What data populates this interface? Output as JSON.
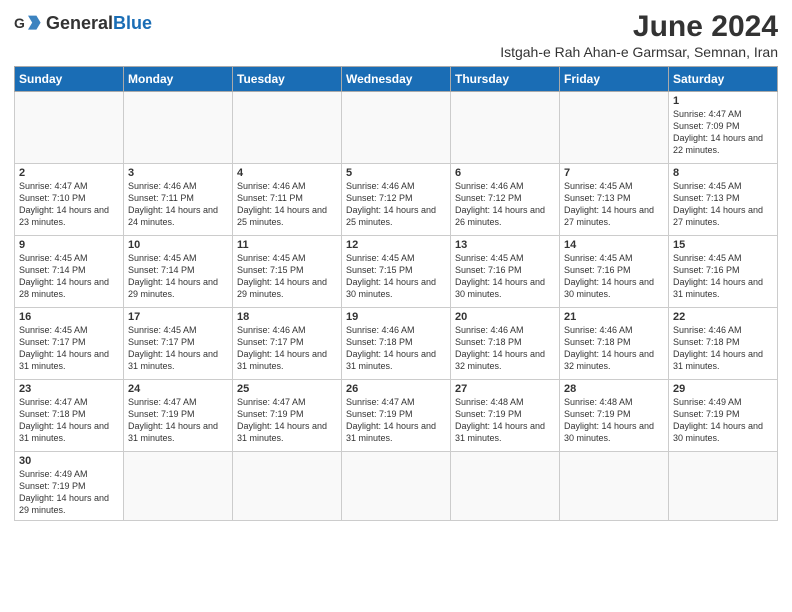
{
  "header": {
    "logo_general": "General",
    "logo_blue": "Blue",
    "month_year": "June 2024",
    "location": "Istgah-e Rah Ahan-e Garmsar, Semnan, Iran"
  },
  "weekdays": [
    "Sunday",
    "Monday",
    "Tuesday",
    "Wednesday",
    "Thursday",
    "Friday",
    "Saturday"
  ],
  "weeks": [
    [
      null,
      null,
      null,
      null,
      null,
      null,
      {
        "day": "1",
        "sunrise": "4:47 AM",
        "sunset": "7:09 PM",
        "daylight": "14 hours and 22 minutes."
      }
    ],
    [
      {
        "day": "2",
        "sunrise": "4:47 AM",
        "sunset": "7:10 PM",
        "daylight": "14 hours and 23 minutes."
      },
      {
        "day": "3",
        "sunrise": "4:46 AM",
        "sunset": "7:11 PM",
        "daylight": "14 hours and 24 minutes."
      },
      {
        "day": "4",
        "sunrise": "4:46 AM",
        "sunset": "7:11 PM",
        "daylight": "14 hours and 25 minutes."
      },
      {
        "day": "5",
        "sunrise": "4:46 AM",
        "sunset": "7:12 PM",
        "daylight": "14 hours and 25 minutes."
      },
      {
        "day": "6",
        "sunrise": "4:46 AM",
        "sunset": "7:12 PM",
        "daylight": "14 hours and 26 minutes."
      },
      {
        "day": "7",
        "sunrise": "4:45 AM",
        "sunset": "7:13 PM",
        "daylight": "14 hours and 27 minutes."
      },
      {
        "day": "8",
        "sunrise": "4:45 AM",
        "sunset": "7:13 PM",
        "daylight": "14 hours and 27 minutes."
      }
    ],
    [
      {
        "day": "9",
        "sunrise": "4:45 AM",
        "sunset": "7:14 PM",
        "daylight": "14 hours and 28 minutes."
      },
      {
        "day": "10",
        "sunrise": "4:45 AM",
        "sunset": "7:14 PM",
        "daylight": "14 hours and 29 minutes."
      },
      {
        "day": "11",
        "sunrise": "4:45 AM",
        "sunset": "7:15 PM",
        "daylight": "14 hours and 29 minutes."
      },
      {
        "day": "12",
        "sunrise": "4:45 AM",
        "sunset": "7:15 PM",
        "daylight": "14 hours and 30 minutes."
      },
      {
        "day": "13",
        "sunrise": "4:45 AM",
        "sunset": "7:16 PM",
        "daylight": "14 hours and 30 minutes."
      },
      {
        "day": "14",
        "sunrise": "4:45 AM",
        "sunset": "7:16 PM",
        "daylight": "14 hours and 30 minutes."
      },
      {
        "day": "15",
        "sunrise": "4:45 AM",
        "sunset": "7:16 PM",
        "daylight": "14 hours and 31 minutes."
      }
    ],
    [
      {
        "day": "16",
        "sunrise": "4:45 AM",
        "sunset": "7:17 PM",
        "daylight": "14 hours and 31 minutes."
      },
      {
        "day": "17",
        "sunrise": "4:45 AM",
        "sunset": "7:17 PM",
        "daylight": "14 hours and 31 minutes."
      },
      {
        "day": "18",
        "sunrise": "4:46 AM",
        "sunset": "7:17 PM",
        "daylight": "14 hours and 31 minutes."
      },
      {
        "day": "19",
        "sunrise": "4:46 AM",
        "sunset": "7:18 PM",
        "daylight": "14 hours and 31 minutes."
      },
      {
        "day": "20",
        "sunrise": "4:46 AM",
        "sunset": "7:18 PM",
        "daylight": "14 hours and 32 minutes."
      },
      {
        "day": "21",
        "sunrise": "4:46 AM",
        "sunset": "7:18 PM",
        "daylight": "14 hours and 32 minutes."
      },
      {
        "day": "22",
        "sunrise": "4:46 AM",
        "sunset": "7:18 PM",
        "daylight": "14 hours and 31 minutes."
      }
    ],
    [
      {
        "day": "23",
        "sunrise": "4:47 AM",
        "sunset": "7:18 PM",
        "daylight": "14 hours and 31 minutes."
      },
      {
        "day": "24",
        "sunrise": "4:47 AM",
        "sunset": "7:19 PM",
        "daylight": "14 hours and 31 minutes."
      },
      {
        "day": "25",
        "sunrise": "4:47 AM",
        "sunset": "7:19 PM",
        "daylight": "14 hours and 31 minutes."
      },
      {
        "day": "26",
        "sunrise": "4:47 AM",
        "sunset": "7:19 PM",
        "daylight": "14 hours and 31 minutes."
      },
      {
        "day": "27",
        "sunrise": "4:48 AM",
        "sunset": "7:19 PM",
        "daylight": "14 hours and 31 minutes."
      },
      {
        "day": "28",
        "sunrise": "4:48 AM",
        "sunset": "7:19 PM",
        "daylight": "14 hours and 30 minutes."
      },
      {
        "day": "29",
        "sunrise": "4:49 AM",
        "sunset": "7:19 PM",
        "daylight": "14 hours and 30 minutes."
      }
    ],
    [
      {
        "day": "30",
        "sunrise": "4:49 AM",
        "sunset": "7:19 PM",
        "daylight": "14 hours and 29 minutes."
      },
      null,
      null,
      null,
      null,
      null,
      null
    ]
  ]
}
